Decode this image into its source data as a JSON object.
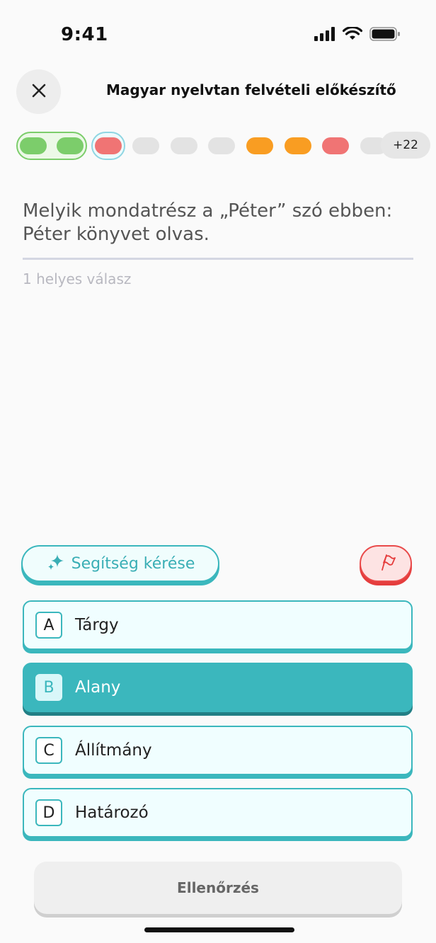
{
  "status_bar": {
    "time": "9:41"
  },
  "header": {
    "course_title": "Magyar nyelvtan felvételi előkészítő"
  },
  "progress": {
    "items": [
      {
        "state": "correct",
        "color": "#7ccd6b"
      },
      {
        "state": "correct",
        "color": "#7ccd6b"
      },
      {
        "state": "current-wrong",
        "color": "#f07474"
      },
      {
        "state": "unanswered",
        "color": "#e3e3e3"
      },
      {
        "state": "unanswered",
        "color": "#e3e3e3"
      },
      {
        "state": "unanswered",
        "color": "#e3e3e3"
      },
      {
        "state": "partial",
        "color": "#f99d22"
      },
      {
        "state": "partial",
        "color": "#f99d22"
      },
      {
        "state": "wrong",
        "color": "#f07474"
      },
      {
        "state": "unanswered",
        "color": "#e3e3e3"
      }
    ],
    "more_count": "+22"
  },
  "question": {
    "text": "Melyik mondatrész a „Péter” szó ebben: Péter könyvet olvas.",
    "hint": "1 helyes válasz"
  },
  "actions": {
    "help_label": "Segítség kérése"
  },
  "options": [
    {
      "letter": "A",
      "text": "Tárgy",
      "selected": false
    },
    {
      "letter": "B",
      "text": "Alany",
      "selected": true
    },
    {
      "letter": "C",
      "text": "Állítmány",
      "selected": false
    },
    {
      "letter": "D",
      "text": "Határozó",
      "selected": false
    }
  ],
  "footer": {
    "check_label": "Ellenőrzés"
  },
  "colors": {
    "accent": "#3bb7bd",
    "danger": "#e94a4a"
  }
}
